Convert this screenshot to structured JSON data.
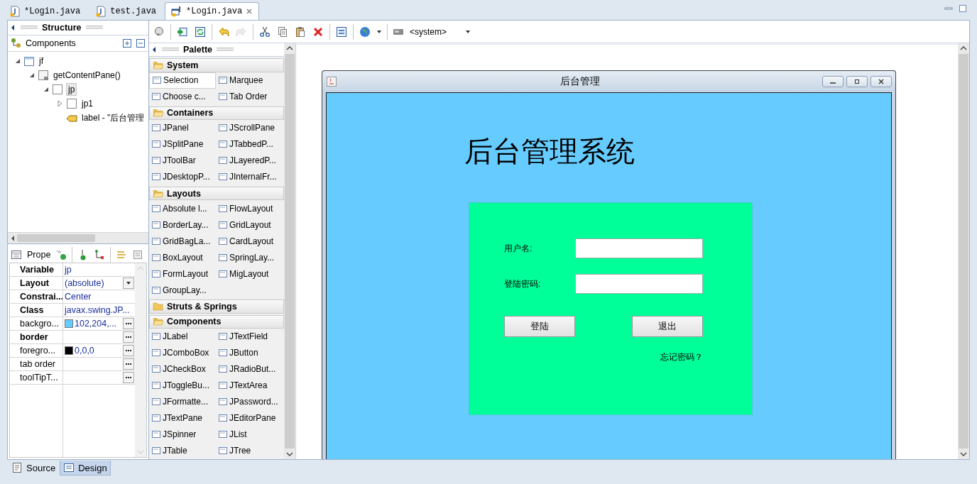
{
  "editor_tabs": [
    {
      "label": "*Login.java",
      "selected": false,
      "kind": "source"
    },
    {
      "label": "test.java",
      "selected": false,
      "kind": "source"
    },
    {
      "label": "*Login.java",
      "selected": true,
      "kind": "design"
    }
  ],
  "structure": {
    "title": "Structure",
    "components_label": "Components",
    "tree": [
      {
        "label": "jf",
        "kind": "frame",
        "expandable": true,
        "expanded": true,
        "selected": false,
        "children": [
          {
            "label": "getContentPane()",
            "kind": "content_pane",
            "expandable": true,
            "expanded": true,
            "selected": false,
            "children": [
              {
                "label": "jp",
                "kind": "panel",
                "expandable": true,
                "expanded": true,
                "selected": true,
                "children": [
                  {
                    "label": "jp1",
                    "kind": "panel",
                    "expandable": true,
                    "expanded": false,
                    "selected": false
                  },
                  {
                    "label": "label - \"后台管理",
                    "kind": "label",
                    "selected": false
                  }
                ]
              }
            ]
          }
        ]
      }
    ]
  },
  "properties": {
    "title": "Prope",
    "rows": [
      {
        "name": "Variable",
        "value": "jp",
        "bold": true,
        "kind": "text"
      },
      {
        "name": "Layout",
        "value": "(absolute)",
        "bold": true,
        "kind": "dropdown"
      },
      {
        "name": "Constrai...",
        "value": "Center",
        "bold": true,
        "kind": "text"
      },
      {
        "name": "Class",
        "value": "javax.swing.JP...",
        "bold": true,
        "kind": "text"
      },
      {
        "name": "backgro...",
        "value": "102,204,...",
        "bold": false,
        "kind": "color",
        "color": "#66ccff"
      },
      {
        "name": "border",
        "bold": true,
        "kind": "dialog"
      },
      {
        "name": "foregro...",
        "value": "0,0,0",
        "bold": false,
        "kind": "color",
        "color": "#000000"
      },
      {
        "name": "tab order",
        "bold": false,
        "kind": "dialog"
      },
      {
        "name": "toolTipT...",
        "bold": false,
        "kind": "dialog"
      }
    ]
  },
  "toolbar": {
    "items": [
      {
        "kind": "bubble",
        "disabled": false
      },
      {
        "kind": "sep"
      },
      {
        "kind": "source",
        "disabled": false
      },
      {
        "kind": "refresh",
        "disabled": false
      },
      {
        "kind": "sep"
      },
      {
        "kind": "undo",
        "disabled": false
      },
      {
        "kind": "redo",
        "disabled": true
      },
      {
        "kind": "sep"
      },
      {
        "kind": "cut",
        "disabled": false
      },
      {
        "kind": "copy",
        "disabled": false
      },
      {
        "kind": "paste",
        "disabled": false
      },
      {
        "kind": "delete",
        "disabled": false
      },
      {
        "kind": "sep"
      },
      {
        "kind": "form",
        "disabled": false
      },
      {
        "kind": "sep"
      },
      {
        "kind": "globe",
        "disabled": false
      },
      {
        "kind": "sep"
      }
    ],
    "locale": "<system>"
  },
  "palette": {
    "title": "Palette",
    "groups": [
      {
        "name": "System",
        "expanded": true,
        "items": [
          {
            "label": "Selection",
            "selected": true
          },
          {
            "label": "Marquee",
            "selected": false
          },
          {
            "label": "Choose c...",
            "selected": false
          },
          {
            "label": "Tab Order",
            "selected": false
          }
        ]
      },
      {
        "name": "Containers",
        "expanded": true,
        "items": [
          {
            "label": "JPanel",
            "selected": false
          },
          {
            "label": "JScrollPane",
            "selected": false
          },
          {
            "label": "JSplitPane",
            "selected": false
          },
          {
            "label": "JTabbedP...",
            "selected": false
          },
          {
            "label": "JToolBar",
            "selected": false
          },
          {
            "label": "JLayeredP...",
            "selected": false
          },
          {
            "label": "JDesktopP...",
            "selected": false
          },
          {
            "label": "JInternalFr...",
            "selected": false
          }
        ]
      },
      {
        "name": "Layouts",
        "expanded": true,
        "items": [
          {
            "label": "Absolute l...",
            "selected": false
          },
          {
            "label": "FlowLayout",
            "selected": false
          },
          {
            "label": "BorderLay...",
            "selected": false
          },
          {
            "label": "GridLayout",
            "selected": false
          },
          {
            "label": "GridBagLa...",
            "selected": false
          },
          {
            "label": "CardLayout",
            "selected": false
          },
          {
            "label": "BoxLayout",
            "selected": false
          },
          {
            "label": "SpringLay...",
            "selected": false
          },
          {
            "label": "FormLayout",
            "selected": false
          },
          {
            "label": "MigLayout",
            "selected": false
          },
          {
            "label": "GroupLay...",
            "selected": false
          }
        ]
      },
      {
        "name": "Struts & Springs",
        "expanded": false
      },
      {
        "name": "Components",
        "expanded": true,
        "items": [
          {
            "label": "JLabel",
            "selected": false
          },
          {
            "label": "JTextField",
            "selected": false
          },
          {
            "label": "JComboBox",
            "selected": false
          },
          {
            "label": "JButton",
            "selected": false
          },
          {
            "label": "JCheckBox",
            "selected": false
          },
          {
            "label": "JRadioBut...",
            "selected": false
          },
          {
            "label": "JToggleBu...",
            "selected": false
          },
          {
            "label": "JTextArea",
            "selected": false
          },
          {
            "label": "JFormatte...",
            "selected": false
          },
          {
            "label": "JPassword...",
            "selected": false
          },
          {
            "label": "JTextPane",
            "selected": false
          },
          {
            "label": "JEditorPane",
            "selected": false
          },
          {
            "label": "JSpinner",
            "selected": false
          },
          {
            "label": "JList",
            "selected": false
          },
          {
            "label": "JTable",
            "selected": false
          },
          {
            "label": "JTree",
            "selected": false
          }
        ]
      }
    ]
  },
  "design": {
    "frame_title": "后台管理",
    "heading": "后台管理系统",
    "fields": [
      {
        "label": "用户名:"
      },
      {
        "label": "登陆密码:"
      }
    ],
    "buttons": [
      "登陆",
      "退出"
    ],
    "link": "忘记密码？"
  },
  "bottom_tabs": [
    {
      "label": "Source",
      "selected": false,
      "kind": "source"
    },
    {
      "label": "Design",
      "selected": true,
      "kind": "design"
    }
  ]
}
